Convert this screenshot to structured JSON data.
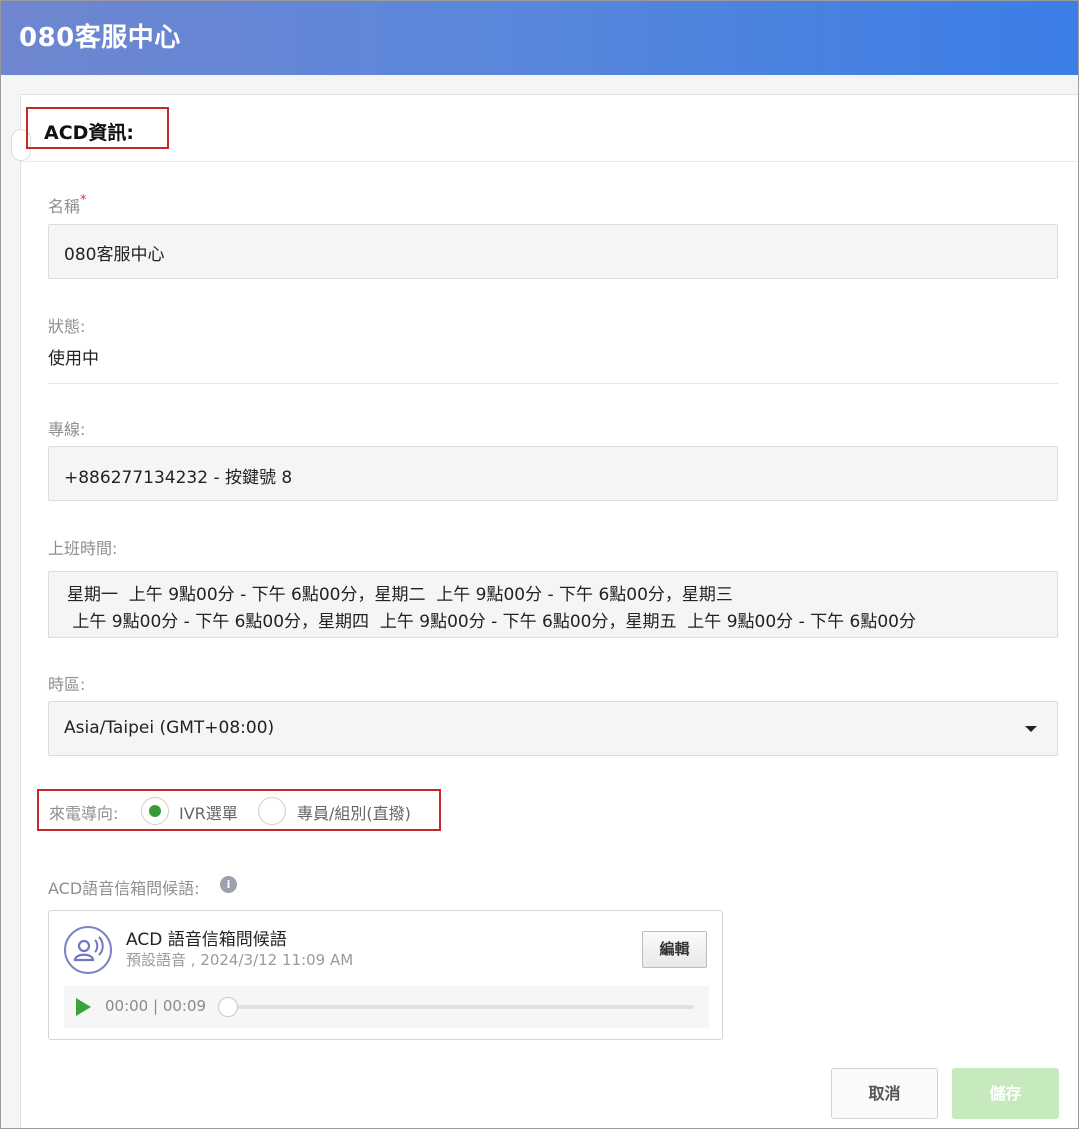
{
  "window": {
    "title": "080客服中心"
  },
  "section": {
    "title": "ACD資訊:"
  },
  "form": {
    "name": {
      "label": "名稱",
      "required_mark": "*",
      "value": "080客服中心"
    },
    "status": {
      "label": "狀態:",
      "value": "使用中"
    },
    "line": {
      "label": "專線:",
      "value": "+886277134232 - 按鍵號 8"
    },
    "hours": {
      "label": "上班時間:",
      "line1": "星期一  上午 9點00分 - 下午 6點00分，星期二  上午 9點00分 - 下午 6點00分，星期三",
      "line2": " 上午 9點00分 - 下午 6點00分，星期四  上午 9點00分 - 下午 6點00分，星期五  上午 9點00分 - 下午 6點00分"
    },
    "timezone": {
      "label": "時區:",
      "value": "Asia/Taipei (GMT+08:00)",
      "icon": "chevron-down-icon"
    },
    "routing": {
      "label": "來電導向:",
      "options": [
        {
          "label": "IVR選單",
          "selected": true
        },
        {
          "label": "專員/組別(直撥)",
          "selected": false
        }
      ]
    },
    "voicemail": {
      "label": "ACD語音信箱問候語:",
      "info_icon": "info-icon",
      "card": {
        "title": "ACD 語音信箱問候語",
        "subtitle": "預設語音 , 2024/3/12 11:09 AM",
        "edit_label": "編輯",
        "player": {
          "time": "00:00 | 00:09",
          "progress": 0
        }
      }
    }
  },
  "actions": {
    "cancel_label": "取消",
    "save_label": "儲存"
  },
  "colors": {
    "accent": "#3a7ee6",
    "radio_selected": "#3a9a3a",
    "save_disabled": "#c6e9bd",
    "highlight_box": "#c62828"
  }
}
